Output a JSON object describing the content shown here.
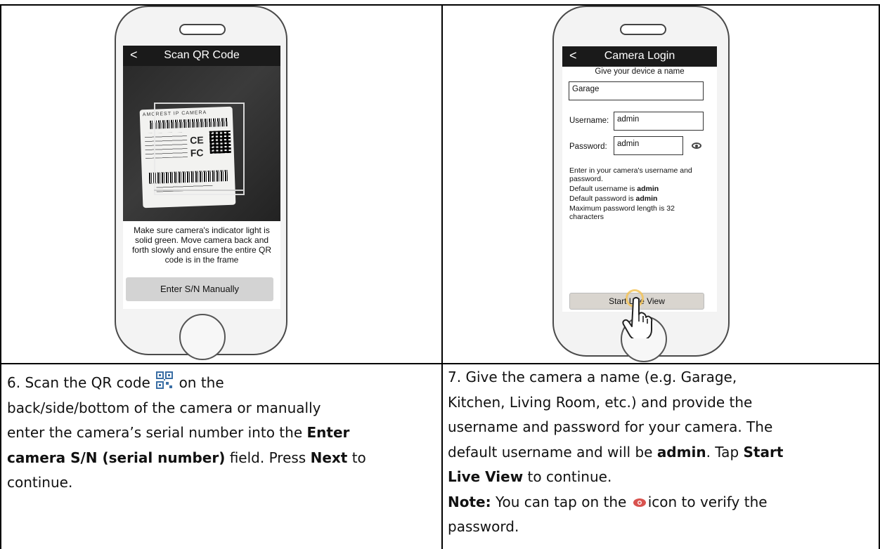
{
  "left_phone": {
    "title": "Scan QR Code",
    "back_glyph": "<",
    "label_brand": "AMCREST IP CAMERA",
    "label_ce": "CE",
    "label_fc": "FC",
    "instruction": "Make sure camera's indicator light is solid green. Move camera back and forth slowly and ensure the entire QR code is in the frame",
    "button": "Enter S/N Manually"
  },
  "right_phone": {
    "title": "Camera Login",
    "back_glyph": "<",
    "caption": "Give your device a name",
    "name_value": "Garage",
    "username_label": "Username:",
    "username_value": "admin",
    "password_label": "Password:",
    "password_value": "admin",
    "info_line1": "Enter in your camera's username and password.",
    "info_default_user_prefix": "Default username is ",
    "info_default_user_value": "admin",
    "info_default_pass_prefix": "Default password is ",
    "info_default_pass_value": "admin",
    "info_max_length": "Maximum password length is 32 characters",
    "button": "Start Live View"
  },
  "step6": {
    "num": "6.",
    "t1": "Scan the QR code",
    "t2": "on the",
    "t3": "back/side/bottom of the camera or manually",
    "t4": "enter the camera’s serial number into the ",
    "b1": "Enter",
    "b2": "camera S/N (serial number)",
    "t5": " field. Press ",
    "b3": "Next",
    "t6": " to",
    "t7": "continue."
  },
  "step7": {
    "num": "7.",
    "t1": " Give the camera a name  (e.g. Garage,",
    "t2": "Kitchen, Living Room, etc.) and provide the",
    "t3": "username and password for your camera. The",
    "t4": "default username and will be ",
    "b1": "admin",
    "t5": ". Tap ",
    "b2": "Start",
    "b3": "Live View",
    "t6": " to continue.",
    "note_label": "Note:",
    "note_t1": " You can tap on the ",
    "note_t2": "icon to verify the",
    "note_t3": "password."
  },
  "icons": {
    "qr_inline": "qr-code-icon",
    "eye_inline": "eye-icon",
    "hand": "tap-hand-icon"
  }
}
